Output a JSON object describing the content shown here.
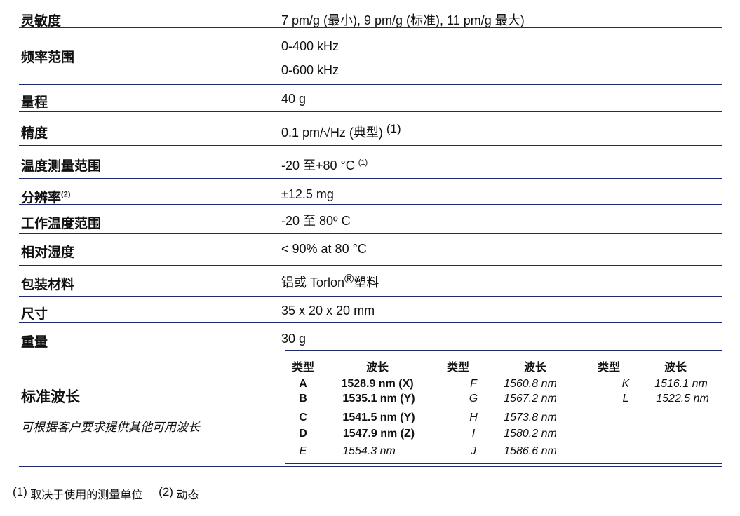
{
  "specs": [
    {
      "label": "灵敏度",
      "value": "7 pm/g (最小), 9 pm/g (标准), 11 pm/g 最大)"
    },
    {
      "label": "频率范围",
      "value": "0-400 kHz",
      "value2": "0-600 kHz"
    },
    {
      "label": "量程",
      "value": "40 g"
    },
    {
      "label": "精度",
      "value": "0.1 pm/√Hz (典型)",
      "value_note": "(1)"
    },
    {
      "label": "温度测量范围",
      "value": "-20 至+80 °C",
      "value_note": "(1)"
    },
    {
      "label": "分辨率",
      "label_note": "(2)",
      "value": "±12.5 mg"
    },
    {
      "label": "工作温度范围",
      "value": "-20 至 80º C"
    },
    {
      "label": "相对湿度",
      "value": "< 90% at 80 °C"
    },
    {
      "label": "包装材料",
      "value_pre": "铝或 Torlon",
      "value_mark": "®",
      "value_post": "塑料"
    },
    {
      "label": "尺寸",
      "value": "35 x 20 x 20 mm"
    },
    {
      "label": "重量",
      "value": "30 g"
    }
  ],
  "wavelength": {
    "title": "标准波长",
    "note": "可根据客户要求提供其他可用波长",
    "headers": [
      "类型",
      "波长",
      "类型",
      "波长",
      "类型",
      "波长"
    ],
    "col1": [
      {
        "type": "A",
        "wl": "1528.9 nm (X)"
      },
      {
        "type": "B",
        "wl": "1535.1 nm (Y)"
      },
      {
        "type": "C",
        "wl": "1541.5 nm (Y)"
      },
      {
        "type": "D",
        "wl": "1547.9 nm (Z)"
      },
      {
        "type": "E",
        "wl": "1554.3 nm"
      }
    ],
    "col2": [
      {
        "type": "F",
        "wl": "1560.8 nm"
      },
      {
        "type": "G",
        "wl": "1567.2 nm"
      },
      {
        "type": "H",
        "wl": "1573.8 nm"
      },
      {
        "type": "I",
        "wl": "1580.2 nm"
      },
      {
        "type": "J",
        "wl": "1586.6 nm"
      }
    ],
    "col3": [
      {
        "type": "K",
        "wl": "1516.1 nm"
      },
      {
        "type": "L",
        "wl": "1522.5 nm"
      }
    ]
  },
  "footer": {
    "note1_mark": "(1)",
    "note1_text": "取决于使用的测量单位",
    "note2_mark": "(2)",
    "note2_text": "动态"
  },
  "colors": {
    "rule": "#1d2a6b"
  }
}
